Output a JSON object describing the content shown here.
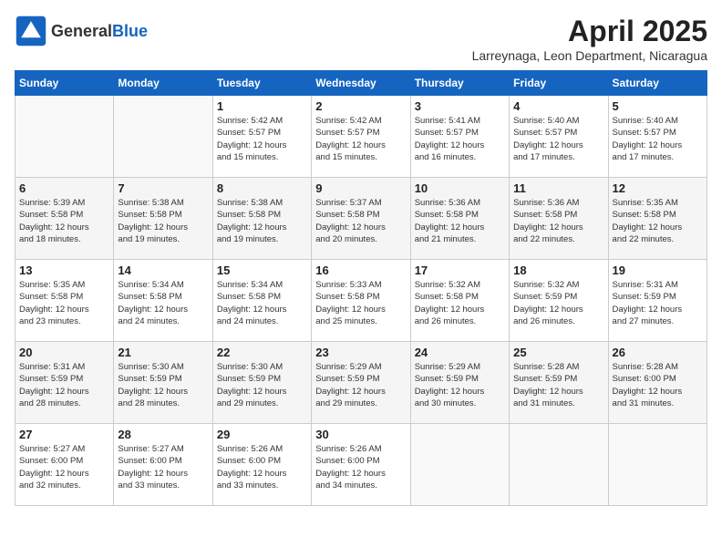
{
  "header": {
    "logo_general": "General",
    "logo_blue": "Blue",
    "month_title": "April 2025",
    "location": "Larreynaga, Leon Department, Nicaragua"
  },
  "weekdays": [
    "Sunday",
    "Monday",
    "Tuesday",
    "Wednesday",
    "Thursday",
    "Friday",
    "Saturday"
  ],
  "weeks": [
    [
      {
        "day": "",
        "info": ""
      },
      {
        "day": "",
        "info": ""
      },
      {
        "day": "1",
        "info": "Sunrise: 5:42 AM\nSunset: 5:57 PM\nDaylight: 12 hours\nand 15 minutes."
      },
      {
        "day": "2",
        "info": "Sunrise: 5:42 AM\nSunset: 5:57 PM\nDaylight: 12 hours\nand 15 minutes."
      },
      {
        "day": "3",
        "info": "Sunrise: 5:41 AM\nSunset: 5:57 PM\nDaylight: 12 hours\nand 16 minutes."
      },
      {
        "day": "4",
        "info": "Sunrise: 5:40 AM\nSunset: 5:57 PM\nDaylight: 12 hours\nand 17 minutes."
      },
      {
        "day": "5",
        "info": "Sunrise: 5:40 AM\nSunset: 5:57 PM\nDaylight: 12 hours\nand 17 minutes."
      }
    ],
    [
      {
        "day": "6",
        "info": "Sunrise: 5:39 AM\nSunset: 5:58 PM\nDaylight: 12 hours\nand 18 minutes."
      },
      {
        "day": "7",
        "info": "Sunrise: 5:38 AM\nSunset: 5:58 PM\nDaylight: 12 hours\nand 19 minutes."
      },
      {
        "day": "8",
        "info": "Sunrise: 5:38 AM\nSunset: 5:58 PM\nDaylight: 12 hours\nand 19 minutes."
      },
      {
        "day": "9",
        "info": "Sunrise: 5:37 AM\nSunset: 5:58 PM\nDaylight: 12 hours\nand 20 minutes."
      },
      {
        "day": "10",
        "info": "Sunrise: 5:36 AM\nSunset: 5:58 PM\nDaylight: 12 hours\nand 21 minutes."
      },
      {
        "day": "11",
        "info": "Sunrise: 5:36 AM\nSunset: 5:58 PM\nDaylight: 12 hours\nand 22 minutes."
      },
      {
        "day": "12",
        "info": "Sunrise: 5:35 AM\nSunset: 5:58 PM\nDaylight: 12 hours\nand 22 minutes."
      }
    ],
    [
      {
        "day": "13",
        "info": "Sunrise: 5:35 AM\nSunset: 5:58 PM\nDaylight: 12 hours\nand 23 minutes."
      },
      {
        "day": "14",
        "info": "Sunrise: 5:34 AM\nSunset: 5:58 PM\nDaylight: 12 hours\nand 24 minutes."
      },
      {
        "day": "15",
        "info": "Sunrise: 5:34 AM\nSunset: 5:58 PM\nDaylight: 12 hours\nand 24 minutes."
      },
      {
        "day": "16",
        "info": "Sunrise: 5:33 AM\nSunset: 5:58 PM\nDaylight: 12 hours\nand 25 minutes."
      },
      {
        "day": "17",
        "info": "Sunrise: 5:32 AM\nSunset: 5:58 PM\nDaylight: 12 hours\nand 26 minutes."
      },
      {
        "day": "18",
        "info": "Sunrise: 5:32 AM\nSunset: 5:59 PM\nDaylight: 12 hours\nand 26 minutes."
      },
      {
        "day": "19",
        "info": "Sunrise: 5:31 AM\nSunset: 5:59 PM\nDaylight: 12 hours\nand 27 minutes."
      }
    ],
    [
      {
        "day": "20",
        "info": "Sunrise: 5:31 AM\nSunset: 5:59 PM\nDaylight: 12 hours\nand 28 minutes."
      },
      {
        "day": "21",
        "info": "Sunrise: 5:30 AM\nSunset: 5:59 PM\nDaylight: 12 hours\nand 28 minutes."
      },
      {
        "day": "22",
        "info": "Sunrise: 5:30 AM\nSunset: 5:59 PM\nDaylight: 12 hours\nand 29 minutes."
      },
      {
        "day": "23",
        "info": "Sunrise: 5:29 AM\nSunset: 5:59 PM\nDaylight: 12 hours\nand 29 minutes."
      },
      {
        "day": "24",
        "info": "Sunrise: 5:29 AM\nSunset: 5:59 PM\nDaylight: 12 hours\nand 30 minutes."
      },
      {
        "day": "25",
        "info": "Sunrise: 5:28 AM\nSunset: 5:59 PM\nDaylight: 12 hours\nand 31 minutes."
      },
      {
        "day": "26",
        "info": "Sunrise: 5:28 AM\nSunset: 6:00 PM\nDaylight: 12 hours\nand 31 minutes."
      }
    ],
    [
      {
        "day": "27",
        "info": "Sunrise: 5:27 AM\nSunset: 6:00 PM\nDaylight: 12 hours\nand 32 minutes."
      },
      {
        "day": "28",
        "info": "Sunrise: 5:27 AM\nSunset: 6:00 PM\nDaylight: 12 hours\nand 33 minutes."
      },
      {
        "day": "29",
        "info": "Sunrise: 5:26 AM\nSunset: 6:00 PM\nDaylight: 12 hours\nand 33 minutes."
      },
      {
        "day": "30",
        "info": "Sunrise: 5:26 AM\nSunset: 6:00 PM\nDaylight: 12 hours\nand 34 minutes."
      },
      {
        "day": "",
        "info": ""
      },
      {
        "day": "",
        "info": ""
      },
      {
        "day": "",
        "info": ""
      }
    ]
  ]
}
